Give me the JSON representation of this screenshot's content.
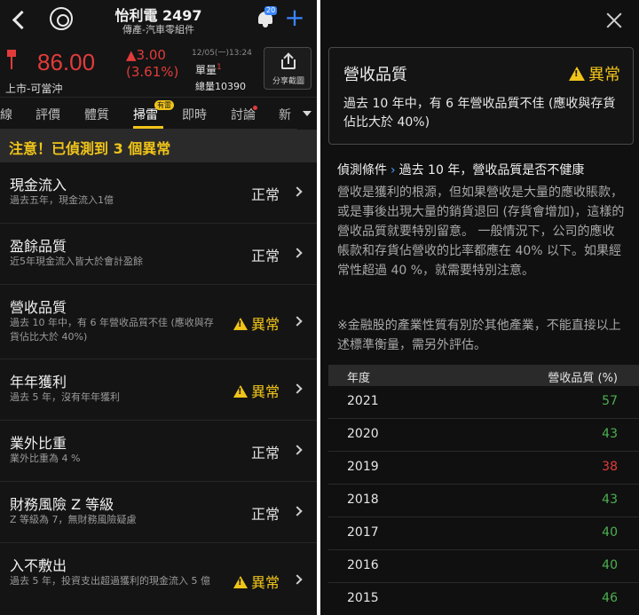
{
  "header": {
    "stock_title": "怡利電 2497",
    "stock_subtitle": "傳產-汽車零組件",
    "notification_badge": "20"
  },
  "quote": {
    "price": "86.00",
    "change": "▲3.00",
    "change_pct": "(3.61%)",
    "listing": "上市-可當沖",
    "datetime": "12/05(一)13:24",
    "unit_volume_label": "單量",
    "unit_volume_value": "1",
    "total_volume": "總量10390",
    "share_label": "分享截圖",
    "price_color": "#e23b3b"
  },
  "tabs": [
    {
      "label": "線"
    },
    {
      "label": "評價"
    },
    {
      "label": "體質"
    },
    {
      "label": "掃雷"
    },
    {
      "label": "即時"
    },
    {
      "label": "討論"
    },
    {
      "label": "新"
    }
  ],
  "tab_badge": "有雷",
  "warning": "注意！已偵測到 3 個異常",
  "items": [
    {
      "title": "現金流入",
      "desc": "過去五年，現金流入1億",
      "status": "正常",
      "abnormal": false
    },
    {
      "title": "盈餘品質",
      "desc": "近5年現金流入皆大於會計盈餘",
      "status": "正常",
      "abnormal": false
    },
    {
      "title": "營收品質",
      "desc": "過去 10 年中，有 6 年營收品質不佳 (應收與存貨佔比大於 40%)",
      "status": "異常",
      "abnormal": true
    },
    {
      "title": "年年獲利",
      "desc": "過去 5 年，沒有年年獲利",
      "status": "異常",
      "abnormal": true
    },
    {
      "title": "業外比重",
      "desc": "業外比重為 4 %",
      "status": "正常",
      "abnormal": false
    },
    {
      "title": "財務風險 Z 等級",
      "desc": "Z 等級為 7，無財務風險疑慮",
      "status": "正常",
      "abnormal": false
    },
    {
      "title": "入不敷出",
      "desc": "過去 5 年，投資支出超過獲利的現金流入 5 億",
      "status": "異常",
      "abnormal": true
    }
  ],
  "detail": {
    "title": "營收品質",
    "status": "異常",
    "summary": "過去 10 年中，有 6 年營收品質不佳 (應收與存貨佔比大於 40%)",
    "condition_label": "偵測條件",
    "condition_text": "過去 10 年，營收品質是否不健康",
    "explanation": "營收是獲利的根源，但如果營收是大量的應收賬款，或是事後出現大量的銷貨退回 (存貨會增加)，這樣的營收品質就要特別留意。 一般情況下，公司的應收帳款和存貨佔營收的比率都應在 40% 以下。如果經常性超過 40 %，就需要特別注意。",
    "note": "※金融股的產業性質有別於其他產業，不能直接以上述標準衡量，需另外評估。",
    "table_headers": {
      "year": "年度",
      "value": "營收品質 (%)"
    },
    "rows": [
      {
        "year": "2021",
        "value": "57",
        "color": "#4caf50"
      },
      {
        "year": "2020",
        "value": "43",
        "color": "#4caf50"
      },
      {
        "year": "2019",
        "value": "38",
        "color": "#e23b3b"
      },
      {
        "year": "2018",
        "value": "43",
        "color": "#4caf50"
      },
      {
        "year": "2017",
        "value": "40",
        "color": "#4caf50"
      },
      {
        "year": "2016",
        "value": "40",
        "color": "#4caf50"
      },
      {
        "year": "2015",
        "value": "46",
        "color": "#4caf50"
      }
    ]
  },
  "colors": {
    "accent": "#f0c419",
    "link": "#3a86ff",
    "up": "#e23b3b",
    "positive": "#4caf50"
  }
}
